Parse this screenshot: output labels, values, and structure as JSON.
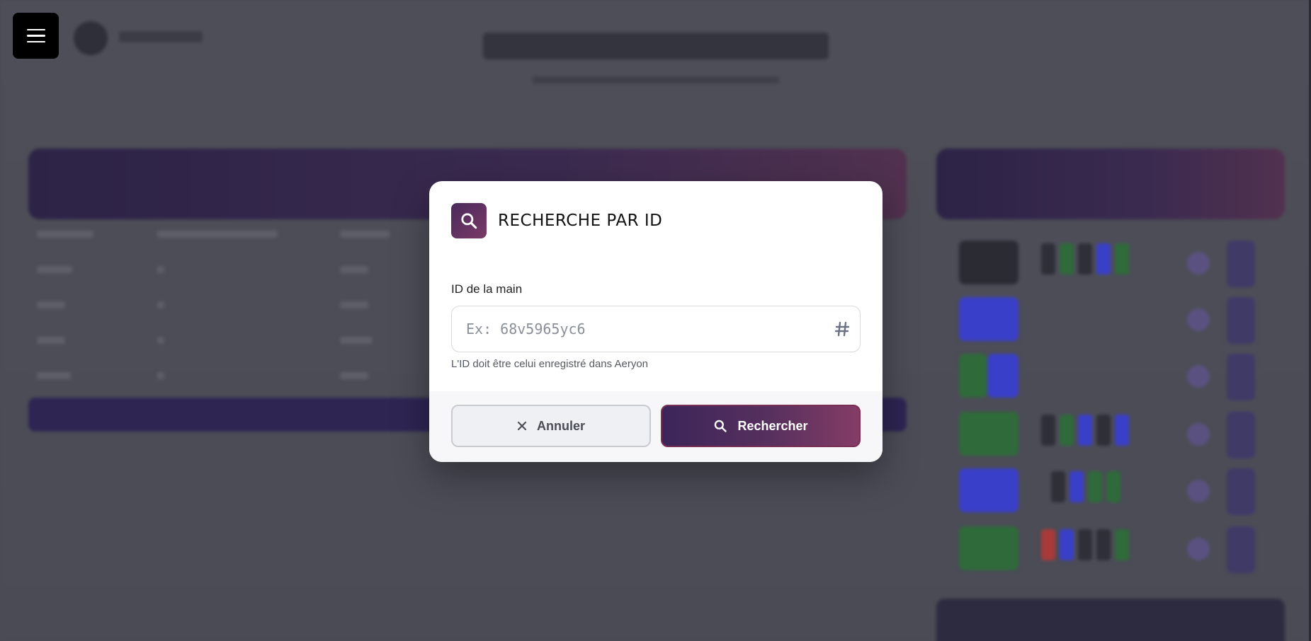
{
  "menu": {
    "icon": "hamburger-icon"
  },
  "modal": {
    "title": "RECHERCHE PAR ID",
    "icon": "search-icon",
    "field_label": "ID de la main",
    "input_value": "",
    "input_placeholder": "Ex: 68v5965yc6",
    "input_icon": "hash-icon",
    "helper_text": "L'ID doit être celui enregistré dans Aeryon",
    "cancel_label": "Annuler",
    "cancel_icon": "close-icon",
    "search_label": "Rechercher",
    "search_icon": "search-icon"
  },
  "colors": {
    "accent_start": "#3c2559",
    "accent_end": "#853c66",
    "overlay": "#4a4b55"
  }
}
